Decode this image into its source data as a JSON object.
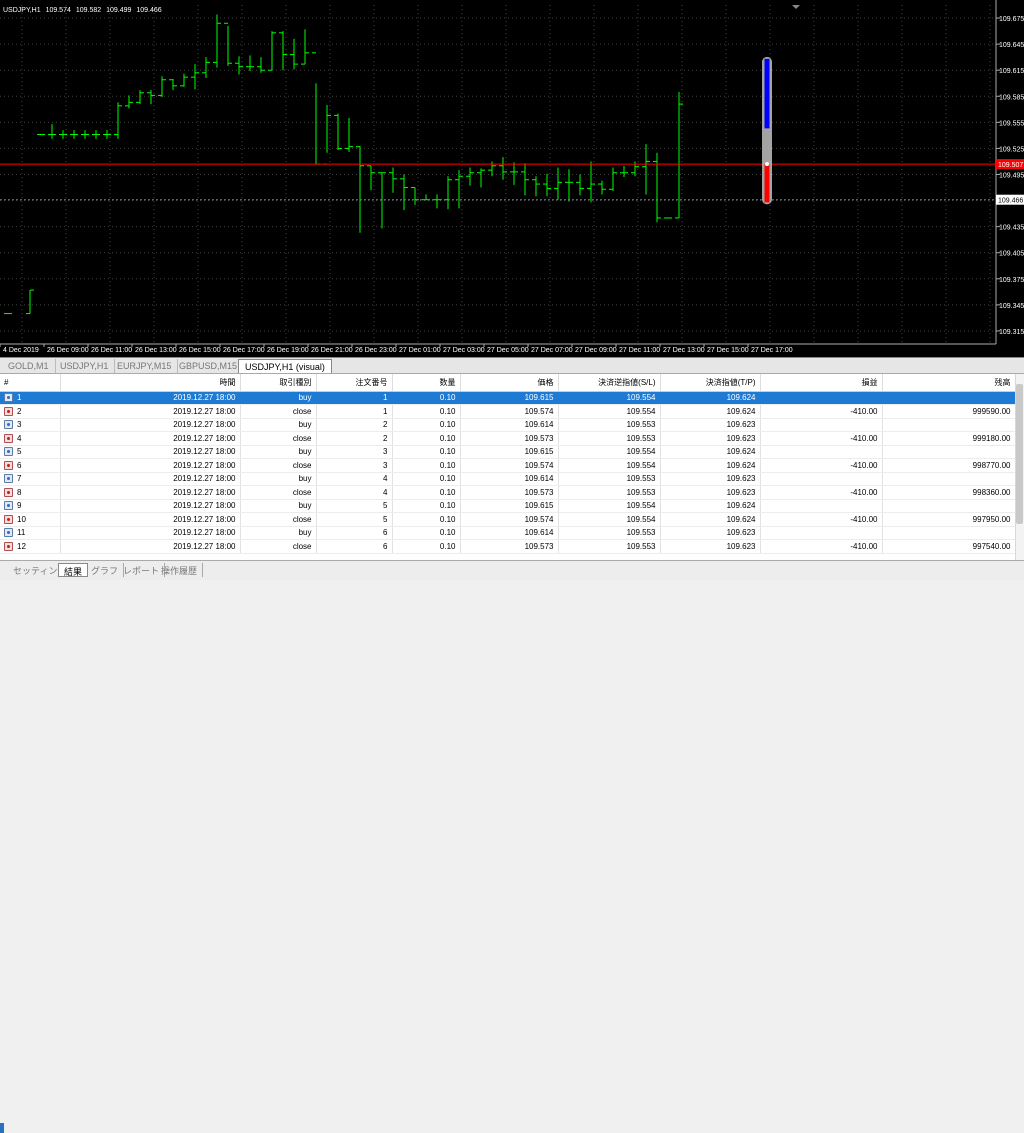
{
  "chart": {
    "symbol": "USDJPY,H1",
    "ohlc": [
      "109.574",
      "109.582",
      "109.499",
      "109.466"
    ],
    "price_axis": [
      "109.675",
      "109.645",
      "109.615",
      "109.585",
      "109.555",
      "109.525",
      "109.495",
      "109.465",
      "109.435",
      "109.405",
      "109.375",
      "109.345",
      "109.315"
    ],
    "current_price_label": "109.507",
    "bid_line_label": "109.466",
    "time_axis": [
      "4 Dec 2019",
      "26 Dec 09:00",
      "26 Dec 11:00",
      "26 Dec 13:00",
      "26 Dec 15:00",
      "26 Dec 17:00",
      "26 Dec 19:00",
      "26 Dec 21:00",
      "26 Dec 23:00",
      "27 Dec 01:00",
      "27 Dec 03:00",
      "27 Dec 05:00",
      "27 Dec 07:00",
      "27 Dec 09:00",
      "27 Dec 11:00",
      "27 Dec 13:00",
      "27 Dec 15:00",
      "27 Dec 17:00"
    ],
    "colors": {
      "background": "#000000",
      "bars": "#00ff00",
      "grid": "#404040",
      "price_line": "#ff0000",
      "bid_line": "#708090",
      "tick_bar_up": "#0000ff",
      "tick_bar_down": "#ff0000"
    },
    "bars": [
      [
        109.335,
        109.335,
        109.335,
        109.335
      ],
      [
        109.335,
        109.362,
        109.335,
        109.362
      ],
      [
        109.541,
        109.541,
        109.541,
        109.541
      ],
      [
        109.541,
        109.553,
        109.536,
        109.541
      ],
      [
        109.541,
        109.546,
        109.536,
        109.541
      ],
      [
        109.541,
        109.546,
        109.536,
        109.541
      ],
      [
        109.541,
        109.546,
        109.536,
        109.541
      ],
      [
        109.541,
        109.546,
        109.536,
        109.541
      ],
      [
        109.541,
        109.546,
        109.536,
        109.541
      ],
      [
        109.541,
        109.578,
        109.536,
        109.574
      ],
      [
        109.574,
        109.586,
        109.571,
        109.578
      ],
      [
        109.578,
        109.592,
        109.576,
        109.589
      ],
      [
        109.589,
        109.592,
        109.576,
        109.586
      ],
      [
        109.586,
        109.608,
        109.584,
        109.604
      ],
      [
        109.604,
        109.605,
        109.592,
        109.597
      ],
      [
        109.597,
        109.611,
        109.596,
        109.607
      ],
      [
        109.607,
        109.622,
        109.593,
        109.612
      ],
      [
        109.612,
        109.63,
        109.606,
        109.624
      ],
      [
        109.624,
        109.679,
        109.618,
        109.669
      ],
      [
        109.669,
        109.666,
        109.62,
        109.623
      ],
      [
        109.623,
        109.631,
        109.61,
        109.619
      ],
      [
        109.619,
        109.632,
        109.614,
        109.619
      ],
      [
        109.619,
        109.63,
        109.612,
        109.615
      ],
      [
        109.615,
        109.66,
        109.615,
        109.658
      ],
      [
        109.658,
        109.66,
        109.615,
        109.633
      ],
      [
        109.633,
        109.651,
        109.616,
        109.622
      ],
      [
        109.622,
        109.662,
        109.622,
        109.635
      ],
      [
        109.635,
        109.6,
        109.507,
        109.507
      ],
      [
        109.507,
        109.575,
        109.52,
        109.563
      ],
      [
        109.563,
        109.565,
        109.523,
        109.525
      ],
      [
        109.525,
        109.56,
        109.521,
        109.527
      ],
      [
        109.527,
        109.528,
        109.428,
        109.505
      ],
      [
        109.505,
        109.505,
        109.477,
        109.497
      ],
      [
        109.497,
        109.497,
        109.433,
        109.497
      ],
      [
        109.497,
        109.503,
        109.474,
        109.49
      ],
      [
        109.49,
        109.495,
        109.454,
        109.48
      ],
      [
        109.48,
        109.48,
        109.46,
        109.466
      ],
      [
        109.466,
        109.472,
        109.466,
        109.466
      ],
      [
        109.466,
        109.472,
        109.456,
        109.466
      ],
      [
        109.466,
        109.493,
        109.455,
        109.489
      ],
      [
        109.489,
        109.5,
        109.456,
        109.493
      ],
      [
        109.493,
        109.503,
        109.482,
        109.497
      ],
      [
        109.497,
        109.502,
        109.48,
        109.5
      ],
      [
        109.5,
        109.51,
        109.493,
        109.505
      ],
      [
        109.505,
        109.515,
        109.489,
        109.498
      ],
      [
        109.498,
        109.509,
        109.483,
        109.498
      ],
      [
        109.498,
        109.508,
        109.471,
        109.489
      ],
      [
        109.489,
        109.493,
        109.47,
        109.484
      ],
      [
        109.484,
        109.496,
        109.47,
        109.479
      ],
      [
        109.479,
        109.503,
        109.466,
        109.486
      ],
      [
        109.486,
        109.501,
        109.464,
        109.486
      ],
      [
        109.486,
        109.495,
        109.471,
        109.479
      ],
      [
        109.479,
        109.51,
        109.463,
        109.484
      ],
      [
        109.484,
        109.488,
        109.472,
        109.478
      ],
      [
        109.478,
        109.503,
        109.476,
        109.497
      ],
      [
        109.497,
        109.505,
        109.492,
        109.497
      ],
      [
        109.497,
        109.51,
        109.493,
        109.504
      ],
      [
        109.504,
        109.53,
        109.472,
        109.51
      ],
      [
        109.51,
        109.52,
        109.44,
        109.445
      ],
      [
        109.445,
        109.445,
        109.445,
        109.445
      ],
      [
        109.445,
        109.59,
        109.445,
        109.576
      ]
    ],
    "tick_bar": {
      "high": 109.628,
      "low": 109.463,
      "open": 109.548,
      "close": 109.507
    }
  },
  "chart_tabs": [
    "GOLD,M1",
    "USDJPY,H1",
    "EURJPY,M15",
    "GBPUSD,M15",
    "USDJPY,H1 (visual)"
  ],
  "table": {
    "headers": [
      "#",
      "時間",
      "取引種別",
      "注文番号",
      "数量",
      "価格",
      "決済逆指値(S/L)",
      "決済指値(T/P)",
      "損益",
      "残高"
    ],
    "rows": [
      [
        "1",
        "2019.12.27 18:00",
        "buy",
        "1",
        "0.10",
        "109.615",
        "109.554",
        "109.624",
        "",
        ""
      ],
      [
        "2",
        "2019.12.27 18:00",
        "close",
        "1",
        "0.10",
        "109.574",
        "109.554",
        "109.624",
        "-410.00",
        "999590.00"
      ],
      [
        "3",
        "2019.12.27 18:00",
        "buy",
        "2",
        "0.10",
        "109.614",
        "109.553",
        "109.623",
        "",
        ""
      ],
      [
        "4",
        "2019.12.27 18:00",
        "close",
        "2",
        "0.10",
        "109.573",
        "109.553",
        "109.623",
        "-410.00",
        "999180.00"
      ],
      [
        "5",
        "2019.12.27 18:00",
        "buy",
        "3",
        "0.10",
        "109.615",
        "109.554",
        "109.624",
        "",
        ""
      ],
      [
        "6",
        "2019.12.27 18:00",
        "close",
        "3",
        "0.10",
        "109.574",
        "109.554",
        "109.624",
        "-410.00",
        "998770.00"
      ],
      [
        "7",
        "2019.12.27 18:00",
        "buy",
        "4",
        "0.10",
        "109.614",
        "109.553",
        "109.623",
        "",
        ""
      ],
      [
        "8",
        "2019.12.27 18:00",
        "close",
        "4",
        "0.10",
        "109.573",
        "109.553",
        "109.623",
        "-410.00",
        "998360.00"
      ],
      [
        "9",
        "2019.12.27 18:00",
        "buy",
        "5",
        "0.10",
        "109.615",
        "109.554",
        "109.624",
        "",
        ""
      ],
      [
        "10",
        "2019.12.27 18:00",
        "close",
        "5",
        "0.10",
        "109.574",
        "109.554",
        "109.624",
        "-410.00",
        "997950.00"
      ],
      [
        "11",
        "2019.12.27 18:00",
        "buy",
        "6",
        "0.10",
        "109.614",
        "109.553",
        "109.623",
        "",
        ""
      ],
      [
        "12",
        "2019.12.27 18:00",
        "close",
        "6",
        "0.10",
        "109.573",
        "109.553",
        "109.623",
        "-410.00",
        "997540.00"
      ]
    ]
  },
  "bottom_tabs": [
    "セッティング",
    "結果",
    "グラフ",
    "レポート",
    "操作履歴"
  ]
}
